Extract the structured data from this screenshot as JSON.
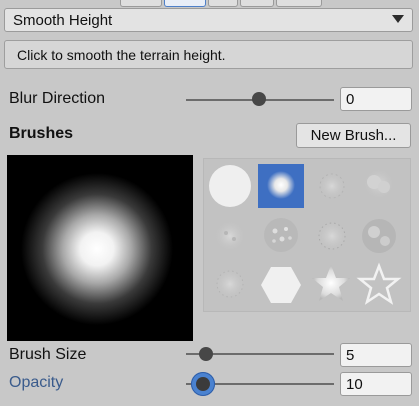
{
  "tool_dropdown": {
    "value": "Smooth Height"
  },
  "help_text": "Click to smooth the terrain height.",
  "blur_direction": {
    "label": "Blur Direction",
    "value": "0",
    "fraction": 0.49
  },
  "brushes": {
    "header": "Brushes",
    "new_brush_label": "New Brush...",
    "selected_index": 1,
    "items": [
      "circle-brush-icon",
      "soft-glow-brush-icon",
      "dotted-cloud-brush-icon",
      "cloud-blob-brush-icon",
      "noise-splatter-brush-icon",
      "speckle-brush-icon",
      "dotted-ring-brush-icon",
      "rough-splat-brush-icon",
      "faint-noise-brush-icon",
      "hexagon-brush-icon",
      "star-glow-brush-icon",
      "star-outline-brush-icon"
    ]
  },
  "brush_size": {
    "label": "Brush Size",
    "value": "5",
    "fraction": 0.13
  },
  "opacity": {
    "label": "Opacity",
    "value": "10",
    "fraction": 0.14
  },
  "colors": {
    "selection_blue": "#3e6fc2",
    "label_blue": "#3a5b8c",
    "panel": "#c8c8c8"
  }
}
